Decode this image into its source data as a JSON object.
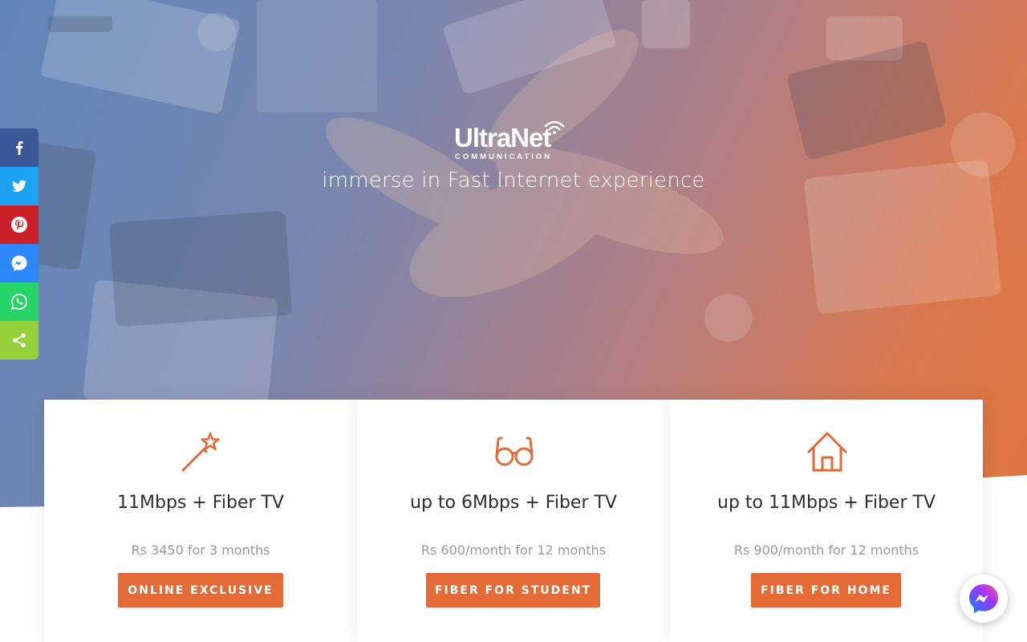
{
  "brand": {
    "name": "UltraNet",
    "subtitle": "COMMUNICATION",
    "tagline": "immerse in Fast Internet experience"
  },
  "share_bar": [
    {
      "name": "facebook",
      "icon": "facebook-icon",
      "color": "#3b5998"
    },
    {
      "name": "twitter",
      "icon": "twitter-icon",
      "color": "#1da1f2"
    },
    {
      "name": "pinterest",
      "icon": "pinterest-icon",
      "color": "#cb2027"
    },
    {
      "name": "messenger",
      "icon": "messenger-icon",
      "color": "#2d88ff"
    },
    {
      "name": "whatsapp",
      "icon": "whatsapp-icon",
      "color": "#25d366"
    },
    {
      "name": "share",
      "icon": "share-icon",
      "color": "#95d03a"
    }
  ],
  "plans": [
    {
      "icon": "magic-wand-icon",
      "title": "11Mbps + Fiber TV",
      "price": "Rs 3450 for 3 months",
      "button": "ONLINE EXCLUSIVE"
    },
    {
      "icon": "glasses-icon",
      "title": "up to 6Mbps + Fiber TV",
      "price": "Rs 600/month for 12 months",
      "button": "FIBER FOR STUDENT"
    },
    {
      "icon": "home-icon",
      "title": "up to 11Mbps + Fiber TV",
      "price": "Rs 900/month for 12 months",
      "button": "FIBER FOR HOME"
    }
  ],
  "colors": {
    "accent": "#e46b38",
    "hero_start": "#5f86b9",
    "hero_end": "#e0743f"
  },
  "chat_widget": {
    "icon": "messenger-icon"
  }
}
